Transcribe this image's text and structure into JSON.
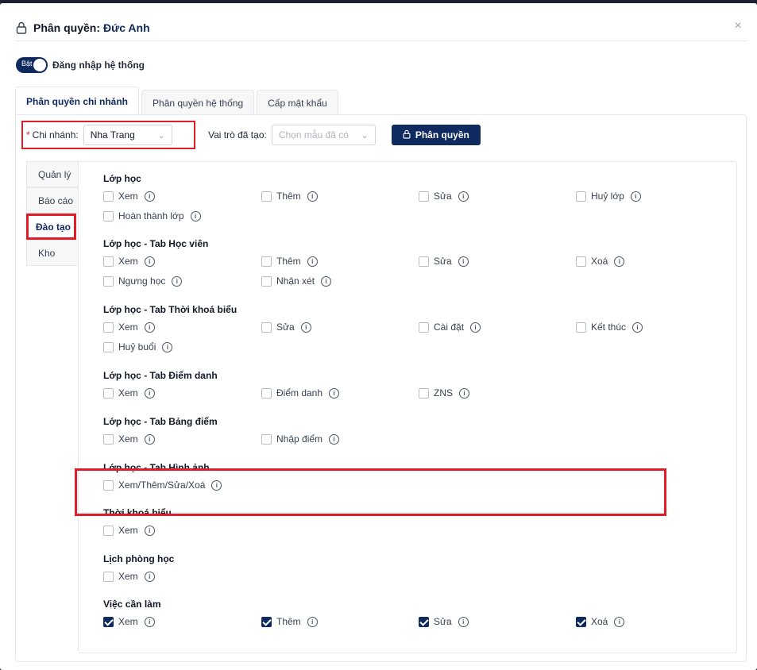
{
  "dialog": {
    "title_prefix": "Phân quyền:",
    "user_name": "Đức Anh",
    "close": "×"
  },
  "login_toggle": {
    "state_label": "Bật",
    "label": "Đăng nhập hệ thống",
    "on": true
  },
  "tabs": [
    {
      "label": "Phân quyền chi nhánh",
      "active": true
    },
    {
      "label": "Phân quyền hệ thống",
      "active": false
    },
    {
      "label": "Cấp mật khẩu",
      "active": false
    }
  ],
  "filters": {
    "required_mark": "*",
    "branch_label": "Chi nhánh:",
    "branch_value": "Nha Trang",
    "role_label": "Vai trò đã tạo:",
    "role_placeholder": "Chọn mẫu đã có",
    "grant_button": "Phân quyền"
  },
  "side_menu": [
    {
      "label": "Quản lý",
      "active": false
    },
    {
      "label": "Báo cáo",
      "active": false
    },
    {
      "label": "Đào tạo",
      "active": true
    },
    {
      "label": "Kho",
      "active": false
    }
  ],
  "groups": [
    {
      "title": "Lớp học",
      "items": [
        {
          "label": "Xem",
          "checked": false
        },
        {
          "label": "Thêm",
          "checked": false
        },
        {
          "label": "Sửa",
          "checked": false
        },
        {
          "label": "Huỷ lớp",
          "checked": false
        },
        {
          "label": "Hoàn thành lớp",
          "checked": false
        }
      ]
    },
    {
      "title": "Lớp học - Tab Học viên",
      "items": [
        {
          "label": "Xem",
          "checked": false
        },
        {
          "label": "Thêm",
          "checked": false
        },
        {
          "label": "Sửa",
          "checked": false
        },
        {
          "label": "Xoá",
          "checked": false
        },
        {
          "label": "Ngưng học",
          "checked": false
        },
        {
          "label": "Nhận xét",
          "checked": false
        }
      ]
    },
    {
      "title": "Lớp học - Tab Thời khoá biểu",
      "items": [
        {
          "label": "Xem",
          "checked": false
        },
        {
          "label": "Sửa",
          "checked": false
        },
        {
          "label": "Cài đặt",
          "checked": false
        },
        {
          "label": "Kết thúc",
          "checked": false
        },
        {
          "label": "Huỷ buổi",
          "checked": false
        }
      ]
    },
    {
      "title": "Lớp học - Tab Điểm danh",
      "items": [
        {
          "label": "Xem",
          "checked": false
        },
        {
          "label": "Điểm danh",
          "checked": false
        },
        {
          "label": "ZNS",
          "checked": false
        }
      ]
    },
    {
      "title": "Lớp học - Tab Bảng điểm",
      "items": [
        {
          "label": "Xem",
          "checked": false
        },
        {
          "label": "Nhập điểm",
          "checked": false
        }
      ]
    },
    {
      "title": "Lớp học - Tab Hình ảnh",
      "items": [
        {
          "label": "Xem/Thêm/Sửa/Xoá",
          "checked": false
        }
      ]
    },
    {
      "title": "Thời khoá biểu",
      "items": [
        {
          "label": "Xem",
          "checked": false
        }
      ]
    },
    {
      "title": "Lịch phòng học",
      "items": [
        {
          "label": "Xem",
          "checked": false
        }
      ]
    },
    {
      "title": "Việc cần làm",
      "items": [
        {
          "label": "Xem",
          "checked": true
        },
        {
          "label": "Thêm",
          "checked": true
        },
        {
          "label": "Sửa",
          "checked": true
        },
        {
          "label": "Xoá",
          "checked": true
        }
      ]
    }
  ],
  "colors": {
    "primary": "#0f2a5f",
    "highlight": "#e11d2a"
  },
  "icons": {
    "info": "i"
  }
}
